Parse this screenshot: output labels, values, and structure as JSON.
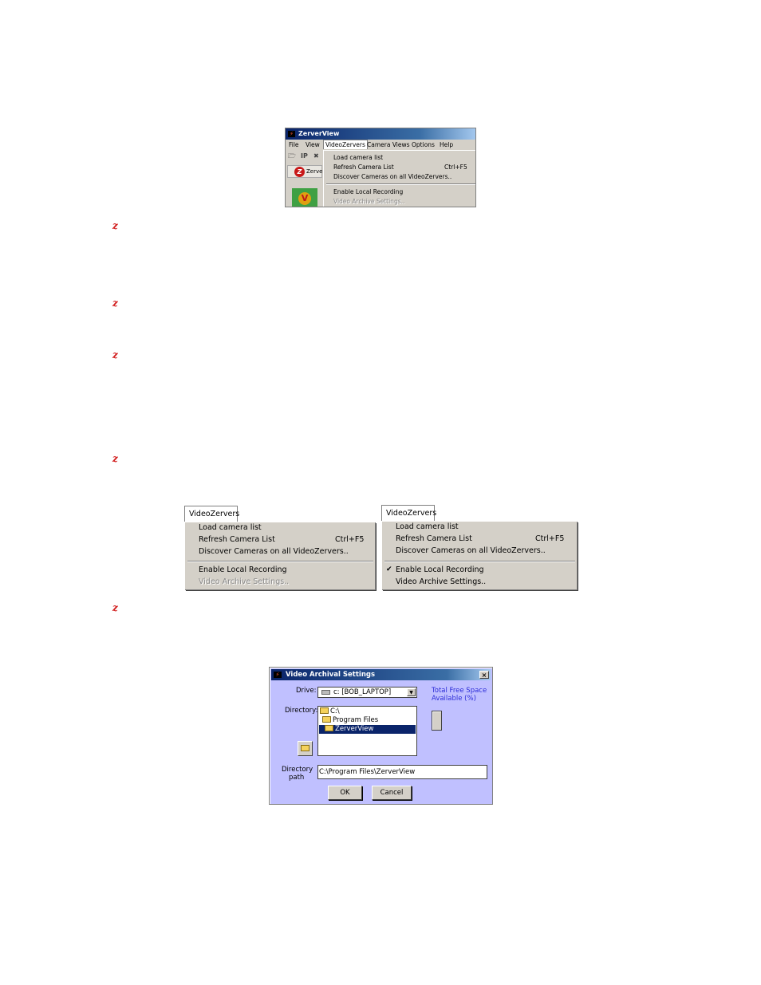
{
  "app_window": {
    "title": "ZerverView",
    "menu": [
      "File",
      "View",
      "VideoZervers",
      "Camera Views",
      "Options",
      "Help"
    ],
    "toolbar_glyphs": "IP",
    "tab_label": "Zerve",
    "dropdown": {
      "items": [
        {
          "label": "Load camera list",
          "shortcut": ""
        },
        {
          "label": "Refresh Camera List",
          "shortcut": "Ctrl+F5"
        },
        {
          "label": "Discover Cameras on all VideoZervers..",
          "shortcut": ""
        },
        {
          "label": "Enable Local Recording",
          "shortcut": ""
        },
        {
          "label": "Video Archive Settings..",
          "shortcut": "",
          "disabled": true
        }
      ]
    }
  },
  "bullet_glyph": "z",
  "menu_disabled": {
    "header": "VideoZervers",
    "items": [
      {
        "label": "Load camera list"
      },
      {
        "label": "Refresh Camera List",
        "shortcut": "Ctrl+F5"
      },
      {
        "label": "Discover Cameras on all VideoZervers.."
      },
      {
        "label": "Enable Local Recording"
      },
      {
        "label": "Video Archive Settings..",
        "disabled": true
      }
    ]
  },
  "menu_enabled": {
    "header": "VideoZervers",
    "items": [
      {
        "label": "Load camera list"
      },
      {
        "label": "Refresh Camera List",
        "shortcut": "Ctrl+F5"
      },
      {
        "label": "Discover Cameras on all VideoZervers.."
      },
      {
        "label": "Enable Local Recording",
        "checked": true,
        "check_glyph": "✔"
      },
      {
        "label": "Video Archive Settings.."
      }
    ]
  },
  "dialog": {
    "title": "Video Archival Settings",
    "close_glyph": "×",
    "drive_label": "Drive:",
    "drive_value": "c: [BOB_LAPTOP]",
    "directory_label": "Directory:",
    "directory_items": [
      "C:\\",
      "Program Files",
      "ZerverView"
    ],
    "selected_directory": "ZerverView",
    "free_space_label_1": "Total Free Space",
    "free_space_label_2": "Available (%)",
    "dir_path_label_1": "Directory",
    "dir_path_label_2": "path",
    "dir_path_value": "C:\\Program Files\\ZerverView",
    "ok_label": "OK",
    "cancel_label": "Cancel",
    "colors": {
      "dialog_bg": "#c0c0ff",
      "label_blue": "#2c2cd8",
      "title_bar": "#0a246a"
    }
  }
}
